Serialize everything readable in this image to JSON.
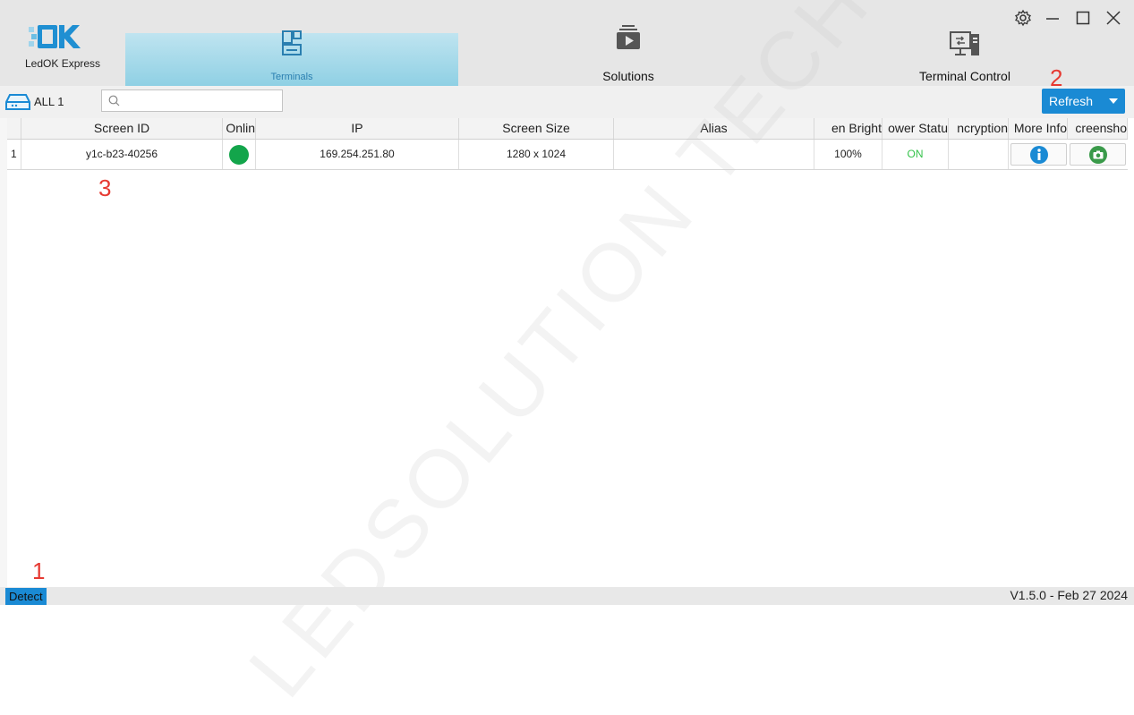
{
  "header": {
    "logo_text": "LedOK Express",
    "tabs": [
      {
        "label": "Terminals",
        "active": true,
        "icon": "terminals-icon"
      },
      {
        "label": "Solutions",
        "active": false,
        "icon": "solutions-icon"
      },
      {
        "label": "Terminal Control",
        "active": false,
        "icon": "terminal-control-icon"
      }
    ],
    "window_controls": [
      "settings-icon",
      "minimize-icon",
      "maximize-icon",
      "close-icon"
    ]
  },
  "toolbar": {
    "group_label": "ALL",
    "group_count": "1",
    "search_placeholder": "",
    "refresh_label": "Refresh"
  },
  "table": {
    "columns": [
      "Screen ID",
      "Onlin",
      "IP",
      "Screen Size",
      "Alias",
      "en Bright",
      "ower Statu",
      "ncryption",
      "More Info",
      "creensho"
    ],
    "sorted_column": "Screen ID",
    "rows": [
      {
        "index": "1",
        "screen_id": "y1c-b23-40256",
        "online": true,
        "ip": "169.254.251.80",
        "screen_size": "1280 x 1024",
        "alias": "",
        "brightness": "100%",
        "power_status": "ON",
        "encryption": ""
      }
    ]
  },
  "annotations": [
    "1",
    "2",
    "3"
  ],
  "watermark": "LEDSOLUTION TECHNOLOGY",
  "statusbar": {
    "detect_label": "Detect",
    "version": "V1.5.0 - Feb 27 2024"
  },
  "colors": {
    "accent": "#1a8ad4",
    "online": "#13a54b",
    "power_on": "#34c24a",
    "annotation": "#e63a32"
  }
}
